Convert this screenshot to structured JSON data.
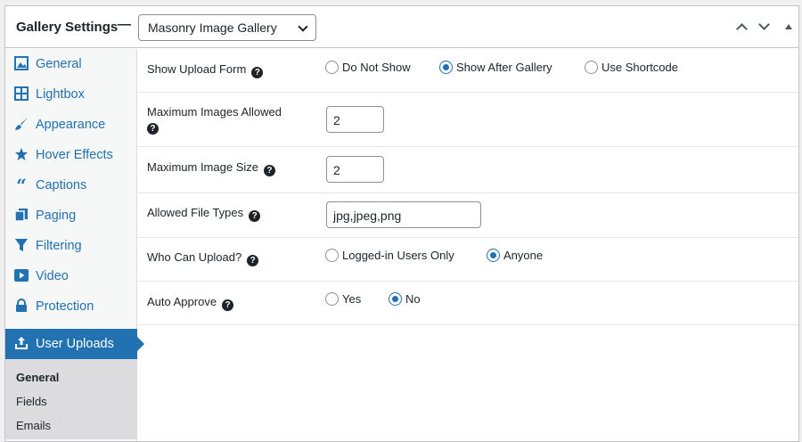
{
  "header": {
    "title": "Gallery Settings",
    "dash": "—",
    "gallery_type": "Masonry Image Gallery"
  },
  "sidebar": {
    "items": [
      {
        "label": "General",
        "icon": "image-icon"
      },
      {
        "label": "Lightbox",
        "icon": "grid-icon"
      },
      {
        "label": "Appearance",
        "icon": "brush-icon"
      },
      {
        "label": "Hover Effects",
        "icon": "star-icon"
      },
      {
        "label": "Captions",
        "icon": "quote-icon"
      },
      {
        "label": "Paging",
        "icon": "pages-icon"
      },
      {
        "label": "Filtering",
        "icon": "funnel-icon"
      },
      {
        "label": "Video",
        "icon": "play-icon"
      },
      {
        "label": "Protection",
        "icon": "lock-icon"
      },
      {
        "label": "User Uploads",
        "icon": "upload-icon"
      }
    ],
    "active_index": 9,
    "subitems": [
      "General",
      "Fields",
      "Emails"
    ]
  },
  "settings": {
    "show_upload_form": {
      "label": "Show Upload Form",
      "options": [
        "Do Not Show",
        "Show After Gallery",
        "Use Shortcode"
      ],
      "selected": "Show After Gallery"
    },
    "max_images": {
      "label": "Maximum Images Allowed",
      "value": "2"
    },
    "max_size": {
      "label": "Maximum Image Size",
      "value": "2"
    },
    "file_types": {
      "label": "Allowed File Types",
      "value": "jpg,jpeg,png"
    },
    "who_can_upload": {
      "label": "Who Can Upload?",
      "options": [
        "Logged-in Users Only",
        "Anyone"
      ],
      "selected": "Anyone"
    },
    "auto_approve": {
      "label": "Auto Approve",
      "options": [
        "Yes",
        "No"
      ],
      "selected": "No"
    }
  },
  "colors": {
    "accent": "#2271b1",
    "text": "#1d2327"
  }
}
